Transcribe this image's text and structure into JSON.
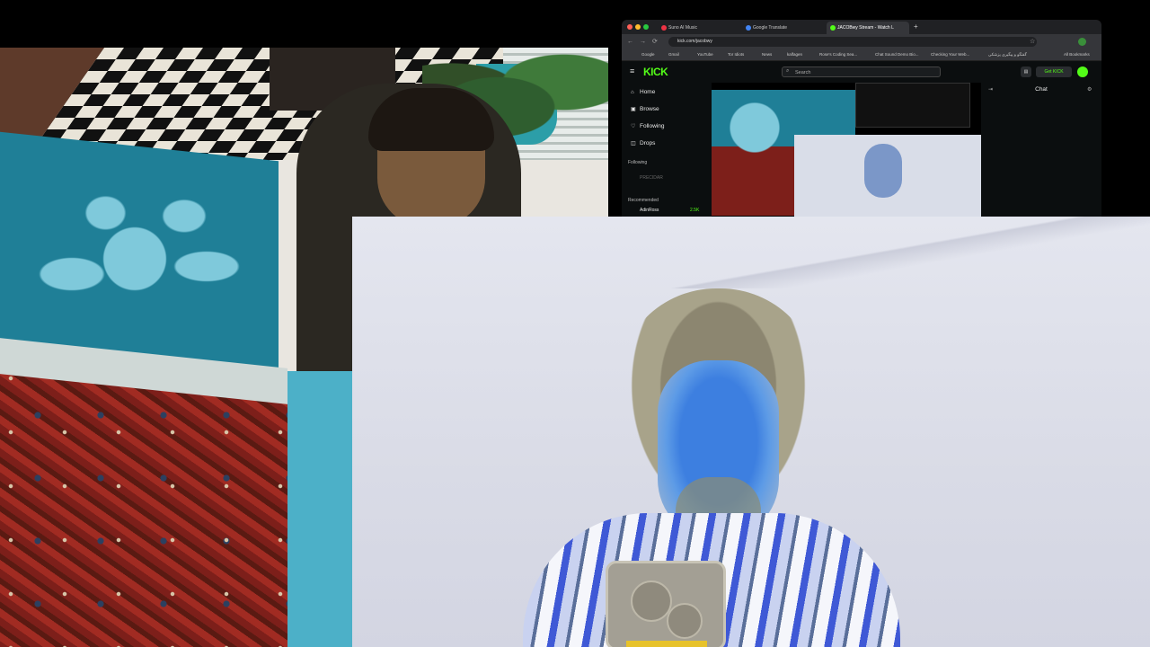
{
  "browser": {
    "tabs": [
      {
        "label": "Suno AI Music",
        "active": false
      },
      {
        "label": "Google Translate",
        "active": false
      },
      {
        "label": "JACOBwy Stream - Watch L",
        "active": true
      }
    ],
    "new_tab_label": "+",
    "url": "kick.com/jacobwy",
    "bookmarks": [
      "Google",
      "Gmail",
      "YouTube",
      "Tor Idiots",
      "News",
      "kalfagen",
      "Rose's Coding Sea...",
      "Chat Sound Demo Bio...",
      "Checking Your Web...",
      "گفتگو و پیگیری پزشکی",
      "All Bookmarks"
    ],
    "nav_back": "←",
    "nav_forward": "→",
    "nav_reload": "⟳"
  },
  "kick": {
    "logo": "KICK",
    "search_placeholder": "Search",
    "sidebar": [
      {
        "icon": "home-icon",
        "glyph": "⌂",
        "label": "Home"
      },
      {
        "icon": "browse-icon",
        "glyph": "▣",
        "label": "Browse"
      },
      {
        "icon": "heart-icon",
        "glyph": "♡",
        "label": "Following"
      },
      {
        "icon": "drops-icon",
        "glyph": "◫",
        "label": "Drops"
      }
    ],
    "following_heading": "Following",
    "following_user": "PRECIDAR",
    "recommended_heading": "Recommended",
    "recommended_user": "AdinRoss",
    "recommended_viewers": "2.5K",
    "get_kick_label": "Get KICK",
    "chat_title": "Chat"
  },
  "colors": {
    "kick_green": "#53fc18",
    "background": "#000000"
  }
}
